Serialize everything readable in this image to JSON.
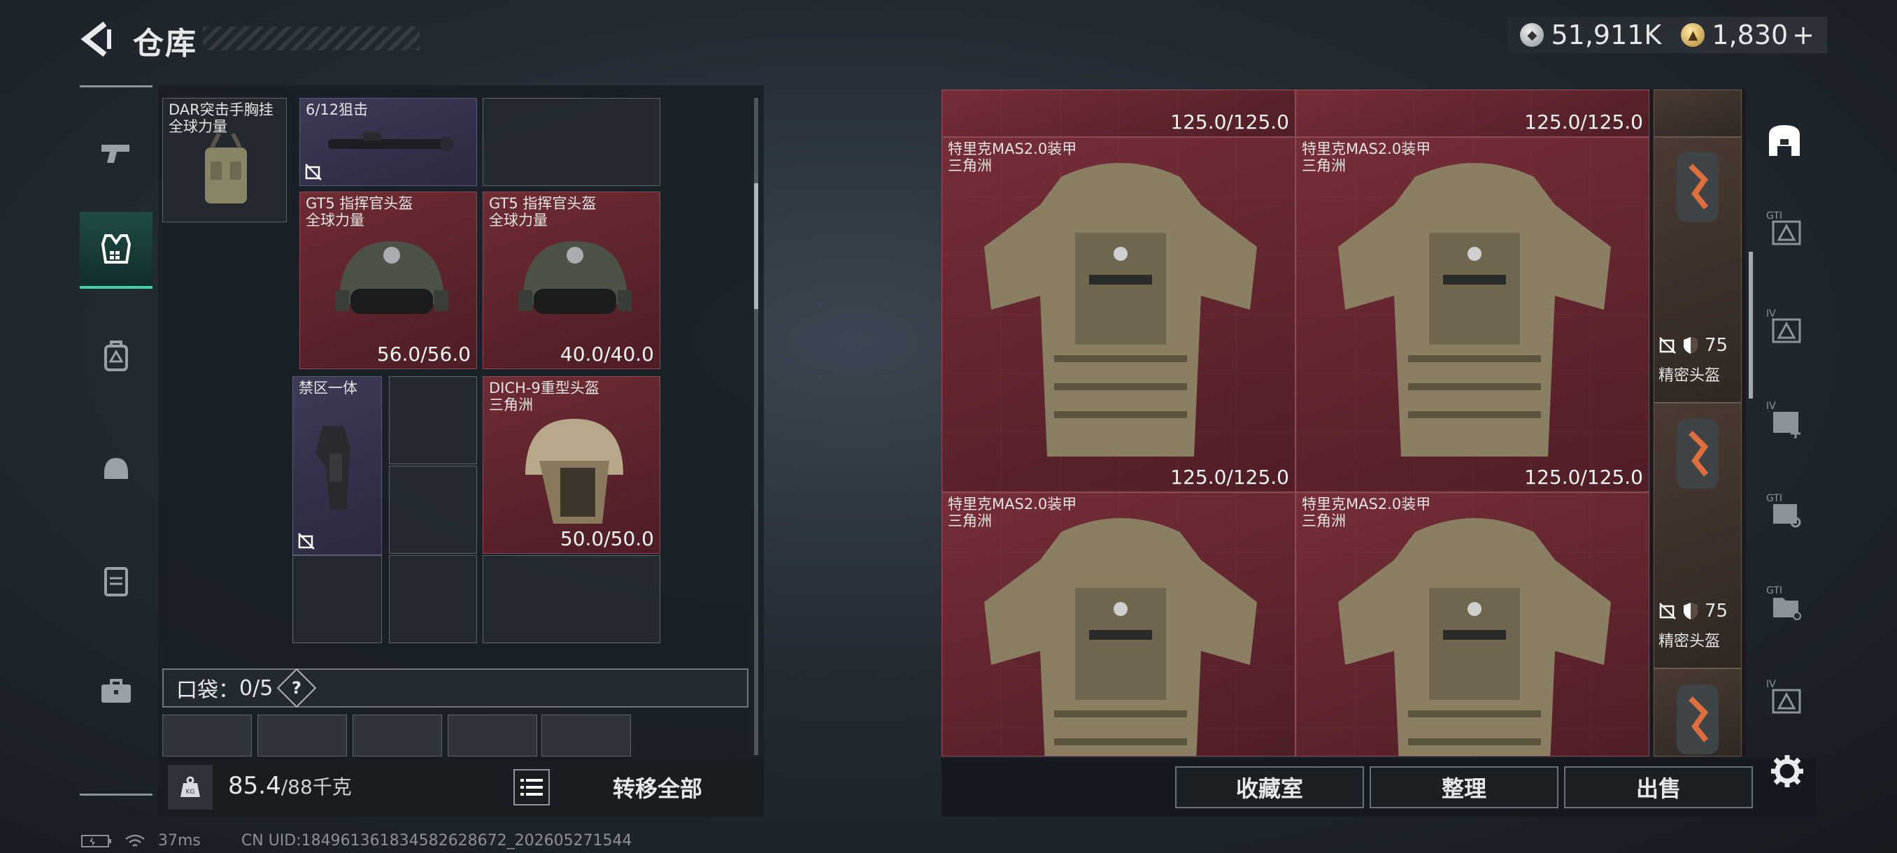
{
  "header": {
    "title": "仓库",
    "currency_silver": "51,911K",
    "currency_gold": "1,830",
    "add_symbol": "+"
  },
  "stash": {
    "items": {
      "chest_rig": {
        "name1": "DAR突击手胸挂",
        "name2": "全球力量"
      },
      "scope": {
        "name1": "6/12狙击"
      },
      "helmet_a": {
        "name1": "GT5 指挥官头盔",
        "name2": "全球力量",
        "durability": "56.0/56.0"
      },
      "helmet_b": {
        "name1": "GT5 指挥官头盔",
        "name2": "全球力量",
        "durability": "40.0/40.0"
      },
      "holster": {
        "name1": "禁区一体"
      },
      "heavy_helmet": {
        "name1": "DICH-9重型头盔",
        "name2": "三角洲",
        "durability": "50.0/50.0"
      }
    },
    "pocket_label": "口袋：",
    "pocket_count": "0/5",
    "pocket_help": "?",
    "weight_value": "85.4",
    "weight_max": "/88千克",
    "transfer_all": "转移全部"
  },
  "container": {
    "vests": [
      {
        "name1": "特里克MAS2.0装甲",
        "name2": "三角洲",
        "durability": "125.0/125.0"
      },
      {
        "name1": "特里克MAS2.0装甲",
        "name2": "三角洲",
        "durability": "125.0/125.0"
      },
      {
        "name1": "特里克MAS2.0装甲",
        "name2": "三角洲",
        "durability": ""
      },
      {
        "name1": "特里克MAS2.0装甲",
        "name2": "三角洲",
        "durability": ""
      }
    ],
    "top_partial": [
      "125.0/125.0",
      "125.0/125.0"
    ],
    "side_helmets": [
      {
        "value": "75",
        "label": "精密头盔"
      },
      {
        "value": "75",
        "label": "精密头盔"
      }
    ]
  },
  "buttons": {
    "collection": "收藏室",
    "organize": "整理",
    "sell": "出售"
  },
  "status": {
    "ping": "37ms",
    "uid": "CN UID:1849613618345826286​72_202605271544"
  }
}
